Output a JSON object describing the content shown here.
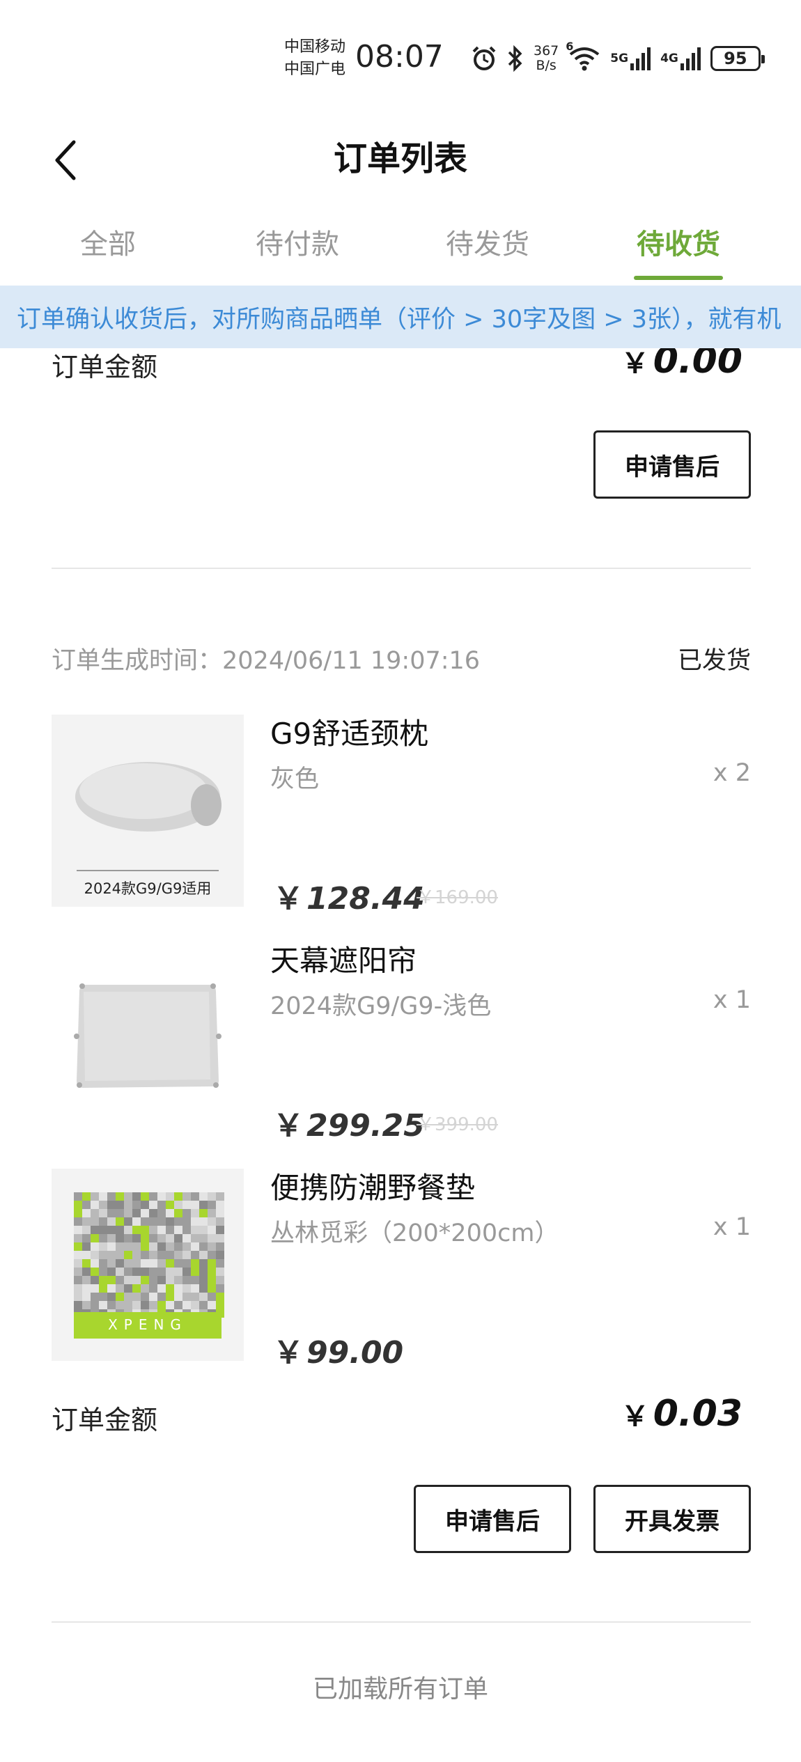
{
  "status_bar": {
    "carrier_1": "中国移动",
    "carrier_2": "中国广电",
    "time": "08:07",
    "net_speed_value": "367",
    "net_speed_unit": "B/s",
    "wifi_badge": "6",
    "net_1": "5G",
    "net_2": "4G",
    "battery": "95",
    "icons": [
      "alarm-icon",
      "bluetooth-icon",
      "wifi-icon",
      "signal-icon",
      "battery-icon"
    ]
  },
  "nav": {
    "title": "订单列表",
    "back_icon": "chevron-left-icon"
  },
  "tabs": [
    {
      "label": "全部",
      "active": false
    },
    {
      "label": "待付款",
      "active": false
    },
    {
      "label": "待发货",
      "active": false
    },
    {
      "label": "待收货",
      "active": true
    }
  ],
  "notice": {
    "text": "订单确认收货后，对所购商品晒单（评价 > 30字及图 > 3张），就有机"
  },
  "order_prev": {
    "amount_label": "订单金额",
    "currency": "￥",
    "amount": "0.00",
    "after_sale_button": "申请售后"
  },
  "order": {
    "time_label": "订单生成时间：",
    "time": "2024/06/11 19:07:16",
    "status": "已发货",
    "products": [
      {
        "name": "G9舒适颈枕",
        "spec": "灰色",
        "qty": "x 2",
        "price": "128.44",
        "original_price": "￥169.00",
        "image_caption": "2024款G9/G9适用"
      },
      {
        "name": "天幕遮阳帘",
        "spec": "2024款G9/G9-浅色",
        "qty": "x 1",
        "price": "299.25",
        "original_price": "￥399.00"
      },
      {
        "name": "便携防潮野餐垫",
        "spec": "丛林觅彩（200*200cm）",
        "qty": "x 1",
        "price": "99.00",
        "original_price": "",
        "image_brand": "XPENG"
      }
    ],
    "amount_label": "订单金额",
    "currency": "￥",
    "amount": "0.03",
    "after_sale_button": "申请售后",
    "invoice_button": "开具发票"
  },
  "footer": {
    "loaded_text": "已加载所有订单"
  },
  "colors": {
    "accent": "#6ea939",
    "notice_bg": "#dbe9f7",
    "notice_text": "#3c8ad6",
    "muted": "#999999"
  }
}
